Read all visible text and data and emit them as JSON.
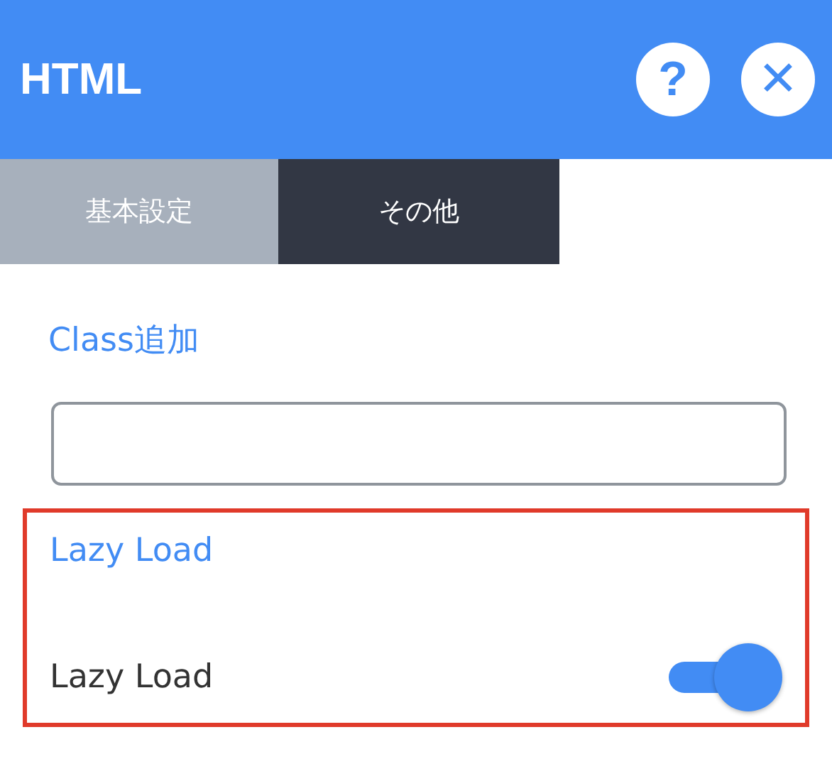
{
  "header": {
    "title": "HTML",
    "help_icon": "?",
    "close_icon": "✕"
  },
  "tabs": [
    {
      "label": "基本設定",
      "selected": false
    },
    {
      "label": "その他",
      "selected": true
    }
  ],
  "sections": [
    {
      "kind": "field",
      "heading": "Class追加",
      "highlighted": false
    },
    {
      "kind": "toggle",
      "heading": "Lazy Load",
      "label": "Lazy Load",
      "on": true,
      "highlighted": true
    }
  ]
}
